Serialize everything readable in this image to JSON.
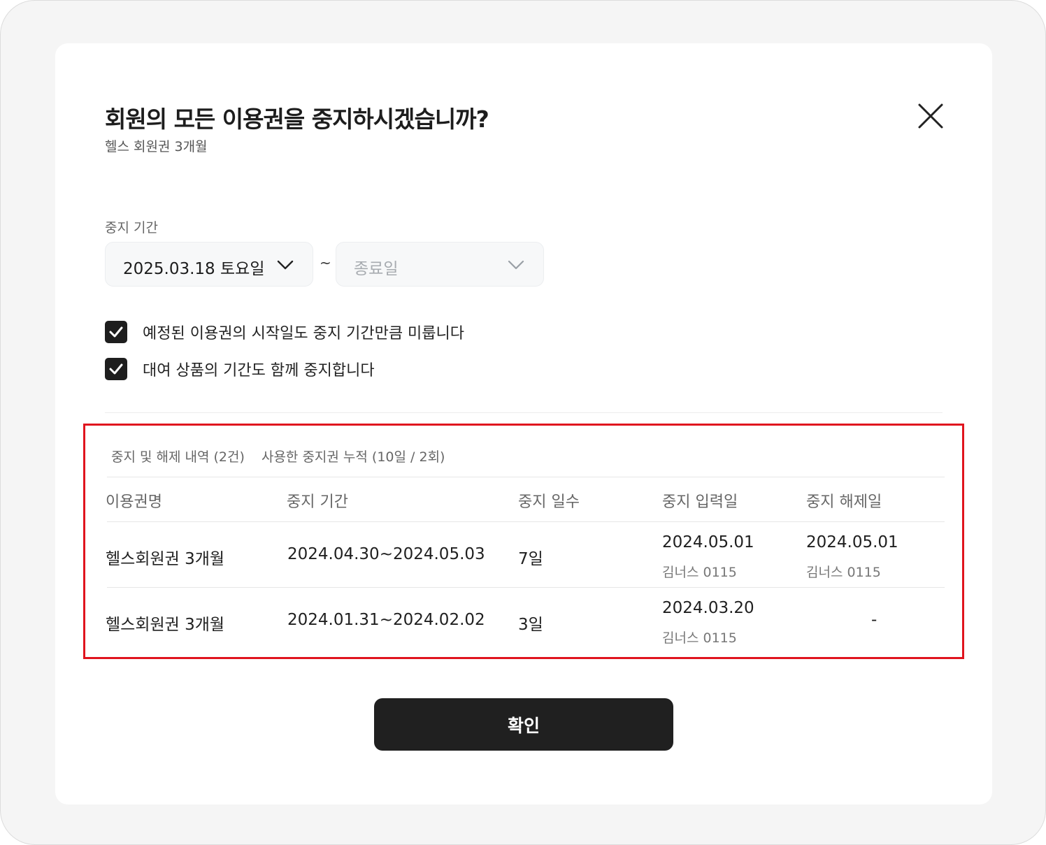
{
  "dialog": {
    "title": "회원의 모든 이용권을 중지하시겠습니까?",
    "subtitle": "헬스 회원권 3개월"
  },
  "period": {
    "label": "중지 기간",
    "start_value": "2025.03.18 토요일",
    "separator": "~",
    "end_placeholder": "종료일"
  },
  "options": [
    {
      "label": "예정된 이용권의 시작일도 중지 기간만큼 미룹니다",
      "checked": true
    },
    {
      "label": "대여 상품의 기간도 함께 중지합니다",
      "checked": true
    }
  ],
  "history": {
    "summary_count": "중지 및 해제 내역 (2건)",
    "summary_accum": "사용한 중지권 누적 (10일 / 2회)",
    "headers": [
      "이용권명",
      "중지 기간",
      "중지 일수",
      "중지 입력일",
      "중지 해제일"
    ],
    "rows": [
      {
        "name": "헬스회원권 3개월",
        "period": "2024.04.30~2024.05.03",
        "days": "7일",
        "input_date": "2024.05.01",
        "input_by": "김너스 0115",
        "release_date": "2024.05.01",
        "release_by": "김너스 0115"
      },
      {
        "name": "헬스회원권 3개월",
        "period": "2024.01.31~2024.02.02",
        "days": "3일",
        "input_date": "2024.03.20",
        "input_by": "김너스 0115",
        "release_date": "-",
        "release_by": ""
      }
    ]
  },
  "confirm_label": "확인",
  "colors": {
    "highlight_border": "#e0141e",
    "button_bg": "#202020",
    "checkbox_bg": "#1e1e1e"
  }
}
